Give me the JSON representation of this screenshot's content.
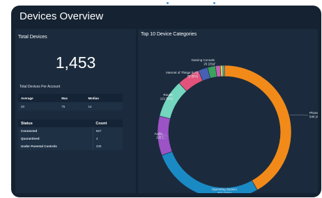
{
  "dashboard": {
    "title": "Devices Overview"
  },
  "total_devices": {
    "label": "Total Devices",
    "value": "1,453"
  },
  "per_account": {
    "label": "Total Devices Per Account",
    "columns": [
      "Average",
      "Max",
      "Median"
    ],
    "values": [
      "20",
      "75",
      "14"
    ]
  },
  "status_table": {
    "columns": [
      "Status",
      "Count"
    ],
    "rows": [
      {
        "status": "Connected",
        "count": "567"
      },
      {
        "status": "Quarantined",
        "count": "4"
      },
      {
        "status": "Under Parental Controls",
        "count": "230"
      }
    ]
  },
  "categories_chart": {
    "title": "Top 10 Device Categories"
  },
  "chart_data": {
    "type": "pie",
    "title": "Top 10 Device Categories",
    "donut": true,
    "slices": [
      {
        "label": "Phone, ...",
        "sublabel": "546 (4...",
        "value": 546,
        "color": "#f28a1a"
      },
      {
        "label": "Operating System",
        "sublabel": "359 (28%)",
        "value": 359,
        "color": "#1a8ac4"
      },
      {
        "label": "Audio,...",
        "sublabel": "125 (...",
        "value": 125,
        "color": "#9b53c6"
      },
      {
        "label": "Router",
        "sublabel": "121 (9%)",
        "value": 121,
        "color": "#74d6be"
      },
      {
        "label": "Internet of Things (IoT)",
        "sublabel": "72 (5%)",
        "value": 72,
        "color": "#e3527a"
      },
      {
        "label": "",
        "sublabel": "",
        "value": 30,
        "color": "#4760b4"
      },
      {
        "label": "Gaming Console",
        "sublabel": "25 (2%)",
        "value": 25,
        "color": "#3aa25a"
      },
      {
        "label": "",
        "sublabel": "",
        "value": 15,
        "color": "#c65fb4"
      },
      {
        "label": "",
        "sublabel": "",
        "value": 8,
        "color": "#e8d247"
      },
      {
        "label": "",
        "sublabel": "",
        "value": 5,
        "color": "#3ec3d6"
      }
    ]
  }
}
